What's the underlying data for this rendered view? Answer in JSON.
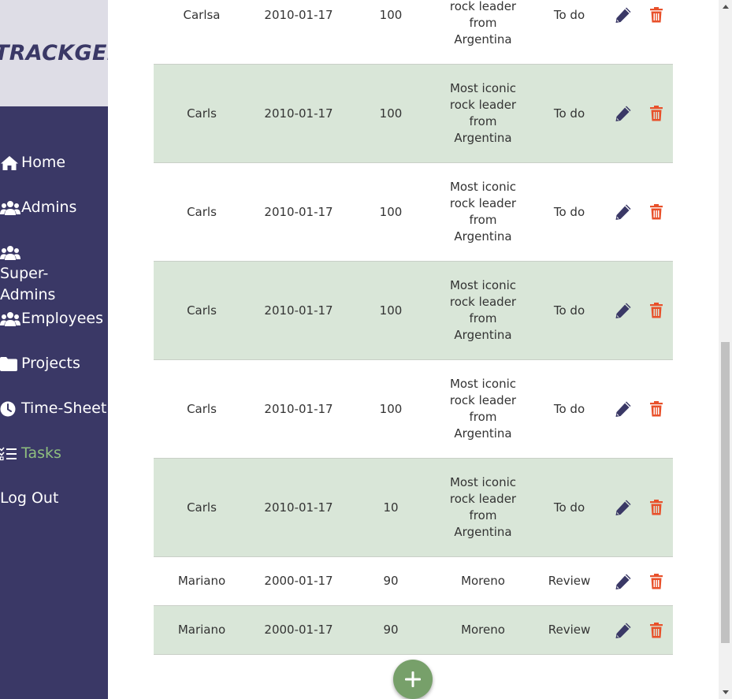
{
  "app": {
    "logo_text": "TRACKGENIX"
  },
  "sidebar": {
    "items": [
      {
        "label": "Home",
        "icon": "home-icon",
        "active": false
      },
      {
        "label": "Admins",
        "icon": "users-icon",
        "active": false
      },
      {
        "label": "Super-Admins",
        "icon": "users-icon",
        "active": false
      },
      {
        "label": "Employees",
        "icon": "users-icon",
        "active": false
      },
      {
        "label": "Projects",
        "icon": "folder-icon",
        "active": false
      },
      {
        "label": "Time-Sheet",
        "icon": "clock-icon",
        "active": false
      },
      {
        "label": "Tasks",
        "icon": "tasks-icon",
        "active": true
      },
      {
        "label": "Log Out",
        "icon": "",
        "active": false
      }
    ]
  },
  "tasks": {
    "rows": [
      {
        "name": "Carlsa",
        "date": "2010-01-17",
        "value": "100",
        "description": "Most iconic rock leader from Argentina",
        "status": "To do"
      },
      {
        "name": "Carls",
        "date": "2010-01-17",
        "value": "100",
        "description": "Most iconic rock leader from Argentina",
        "status": "To do"
      },
      {
        "name": "Carls",
        "date": "2010-01-17",
        "value": "100",
        "description": "Most iconic rock leader from Argentina",
        "status": "To do"
      },
      {
        "name": "Carls",
        "date": "2010-01-17",
        "value": "100",
        "description": "Most iconic rock leader from Argentina",
        "status": "To do"
      },
      {
        "name": "Carls",
        "date": "2010-01-17",
        "value": "100",
        "description": "Most iconic rock leader from Argentina",
        "status": "To do"
      },
      {
        "name": "Carls",
        "date": "2010-01-17",
        "value": "10",
        "description": "Most iconic rock leader from Argentina",
        "status": "To do"
      },
      {
        "name": "Mariano",
        "date": "2000-01-17",
        "value": "90",
        "description": "Moreno",
        "status": "Review"
      },
      {
        "name": "Mariano",
        "date": "2000-01-17",
        "value": "90",
        "description": "Moreno",
        "status": "Review"
      }
    ]
  },
  "colors": {
    "sidebar_bg": "#3a3866",
    "active": "#8fbf7f",
    "row_alt": "#d9e6d8",
    "edit_icon": "#3a3866",
    "delete_icon": "#e8502a",
    "add_button": "#77a06a"
  }
}
